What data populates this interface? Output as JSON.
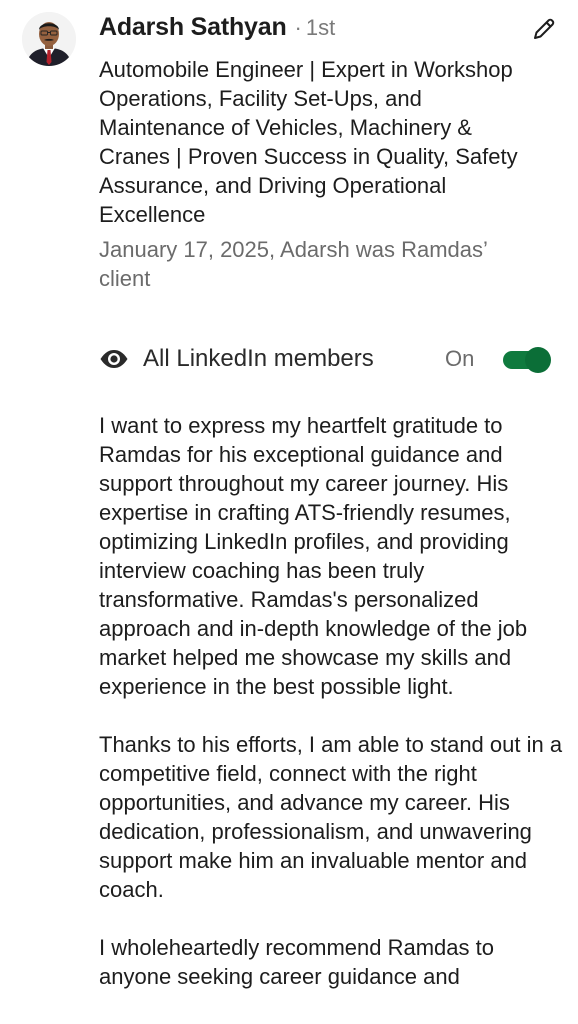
{
  "recommender": {
    "name": "Adarsh Sathyan",
    "separator": "·",
    "degree": "1st",
    "headline": "Automobile Engineer | Expert in Workshop Operations, Facility Set-Ups, and Maintenance of Vehicles, Machinery & Cranes | Proven Success in Quality, Safety Assurance, and Driving Operational Excellence",
    "meta": "January 17, 2025, Adarsh was Ramdas’ client"
  },
  "visibility": {
    "icon": "eye-icon",
    "label": "All LinkedIn members",
    "state_label": "On",
    "enabled": true
  },
  "recommendation": {
    "paragraphs": [
      "I want to express my heartfelt gratitude to Ramdas for his exceptional guidance and support throughout my career journey. His expertise in crafting ATS-friendly resumes, optimizing LinkedIn profiles, and providing interview coaching has been truly transformative. Ramdas's personalized approach and in-depth knowledge of the job market helped me showcase my skills and experience in the best possible light.",
      "Thanks to his efforts, I am able to stand out in a competitive field, connect with the right opportunities, and advance my career. His dedication, professionalism, and unwavering support make him an invaluable mentor and coach.",
      "I wholeheartedly recommend Ramdas to anyone seeking career guidance and"
    ]
  },
  "colors": {
    "toggle_on": "#0f7a3e",
    "secondary_text": "#6b6b6b",
    "primary_text": "#1d1d1d"
  }
}
